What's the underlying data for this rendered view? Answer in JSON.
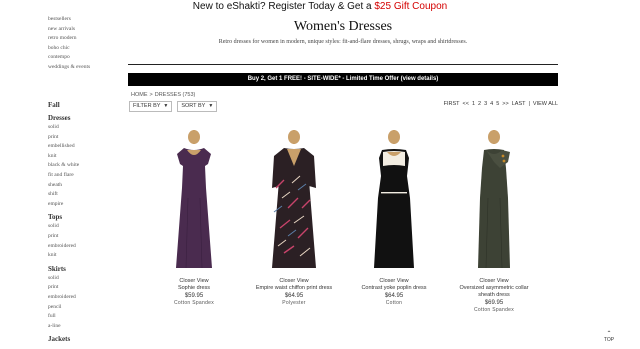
{
  "promo": {
    "text": "New to eShakti? Register Today & Get a ",
    "coupon": "$25 Gift Coupon"
  },
  "topnav": [
    "bestsellers",
    "new arrivals",
    "retro modern",
    "boho chic",
    "contempo",
    "weddings & events"
  ],
  "title": "Women's Dresses",
  "subtitle": "Retro dresses for women in modern, unique styles: fit-and-flare dresses, shrugs, wraps and shirtdresses.",
  "offer": "Buy 2, Get 1 FREE! - SITE-WIDE* - Limited Time Offer (view details)",
  "breadcrumb": {
    "home": "HOME",
    "sep": ">",
    "current": "DRESSES (753)"
  },
  "filter": {
    "filter_label": "FILTER BY",
    "sort_label": "SORT BY"
  },
  "pager": {
    "first": "FIRST",
    "prev": "<<",
    "pages": [
      "1",
      "2",
      "3",
      "4",
      "5"
    ],
    "next": ">>",
    "last": "LAST",
    "divider": "|",
    "view_all": "VIEW ALL"
  },
  "sidebar": [
    {
      "heading": "Fall",
      "items": []
    },
    {
      "heading": "Dresses",
      "items": [
        "solid",
        "print",
        "embellished",
        "knit",
        "black & white",
        "fit and flare",
        "sheath",
        "shift",
        "empire"
      ]
    },
    {
      "heading": "Tops",
      "items": [
        "solid",
        "print",
        "embroidered",
        "knit"
      ]
    },
    {
      "heading": "Skirts",
      "items": [
        "solid",
        "print",
        "embroidered",
        "pencil",
        "full",
        "a-line"
      ]
    },
    {
      "heading": "Jackets",
      "items": []
    }
  ],
  "products": [
    {
      "closer": "Closer View",
      "name": "Sophie dress",
      "price": "$59.95",
      "fabric": "Cotton Spandex",
      "color": "#4a2b4f"
    },
    {
      "closer": "Closer View",
      "name": "Empire waist chiffon print dress",
      "price": "$64.95",
      "fabric": "Polyester",
      "color": "#2b2024"
    },
    {
      "closer": "Closer View",
      "name": "Contrast yoke poplin dress",
      "price": "$64.95",
      "fabric": "Cotton",
      "color": "#111111"
    },
    {
      "closer": "Closer View",
      "name": "Oversized asymmetric collar sheath dress",
      "price": "$69.95",
      "fabric": "Cotton Spandex",
      "color": "#3d4235"
    }
  ],
  "top_button": "TOP"
}
